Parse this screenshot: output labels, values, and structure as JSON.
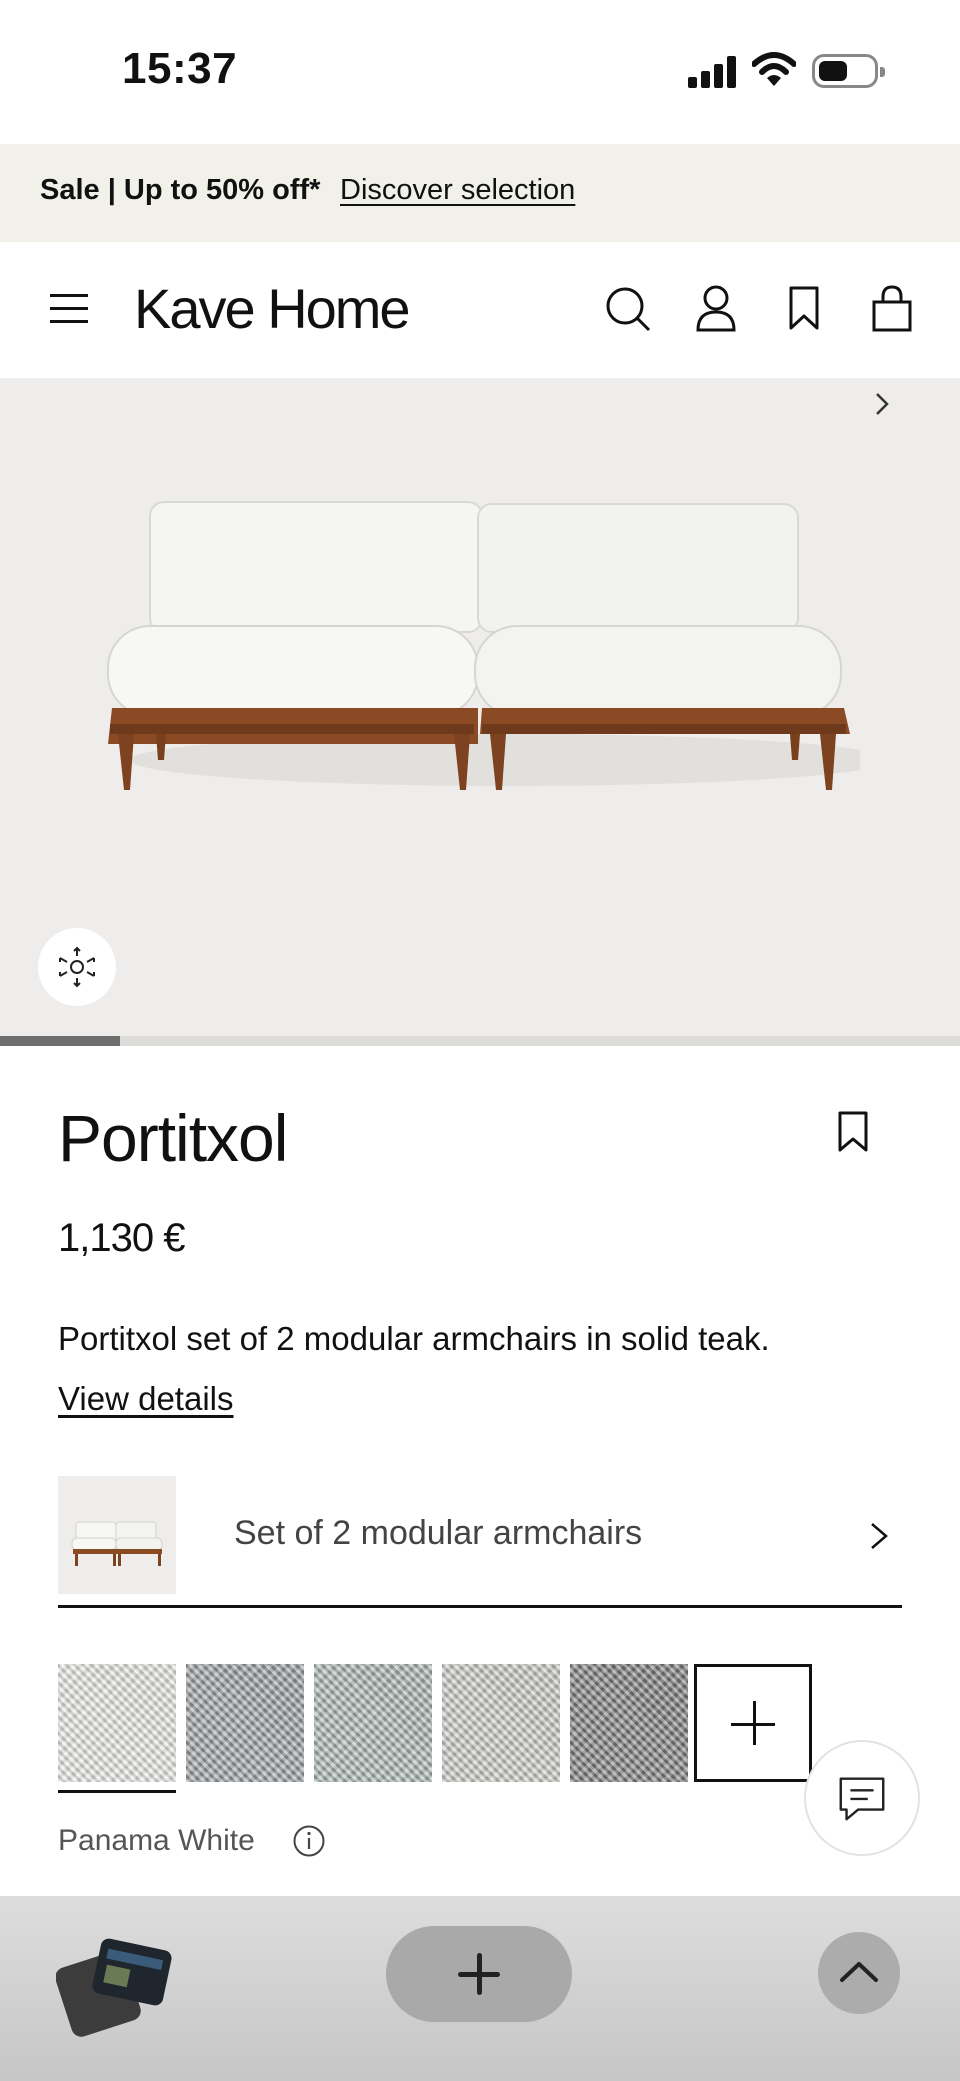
{
  "status_bar": {
    "time": "15:37"
  },
  "promo": {
    "text": "Sale | Up to 50% off*",
    "link": "Discover selection"
  },
  "header": {
    "logo": "Kave Home"
  },
  "product": {
    "title": "Portitxol",
    "price": "1,130 €",
    "description": "Portitxol set of 2 modular armchairs in solid teak.",
    "details_link": "View details",
    "variant_label": "Set of 2 modular armchairs",
    "color_name": "Panama White",
    "gallery_progress": 0.125
  },
  "swatches": [
    {
      "color": "#e6e6e4"
    },
    {
      "color": "#9a9da0"
    },
    {
      "color": "#a7b3b1"
    },
    {
      "color": "#c9c8c3"
    },
    {
      "color": "#7b7b7b"
    }
  ],
  "colors": {
    "promo_bg": "#f1f1ea",
    "gallery_bg": "#eeedeb",
    "teak": "#8a4a24",
    "cushion": "#f3f3f0"
  }
}
